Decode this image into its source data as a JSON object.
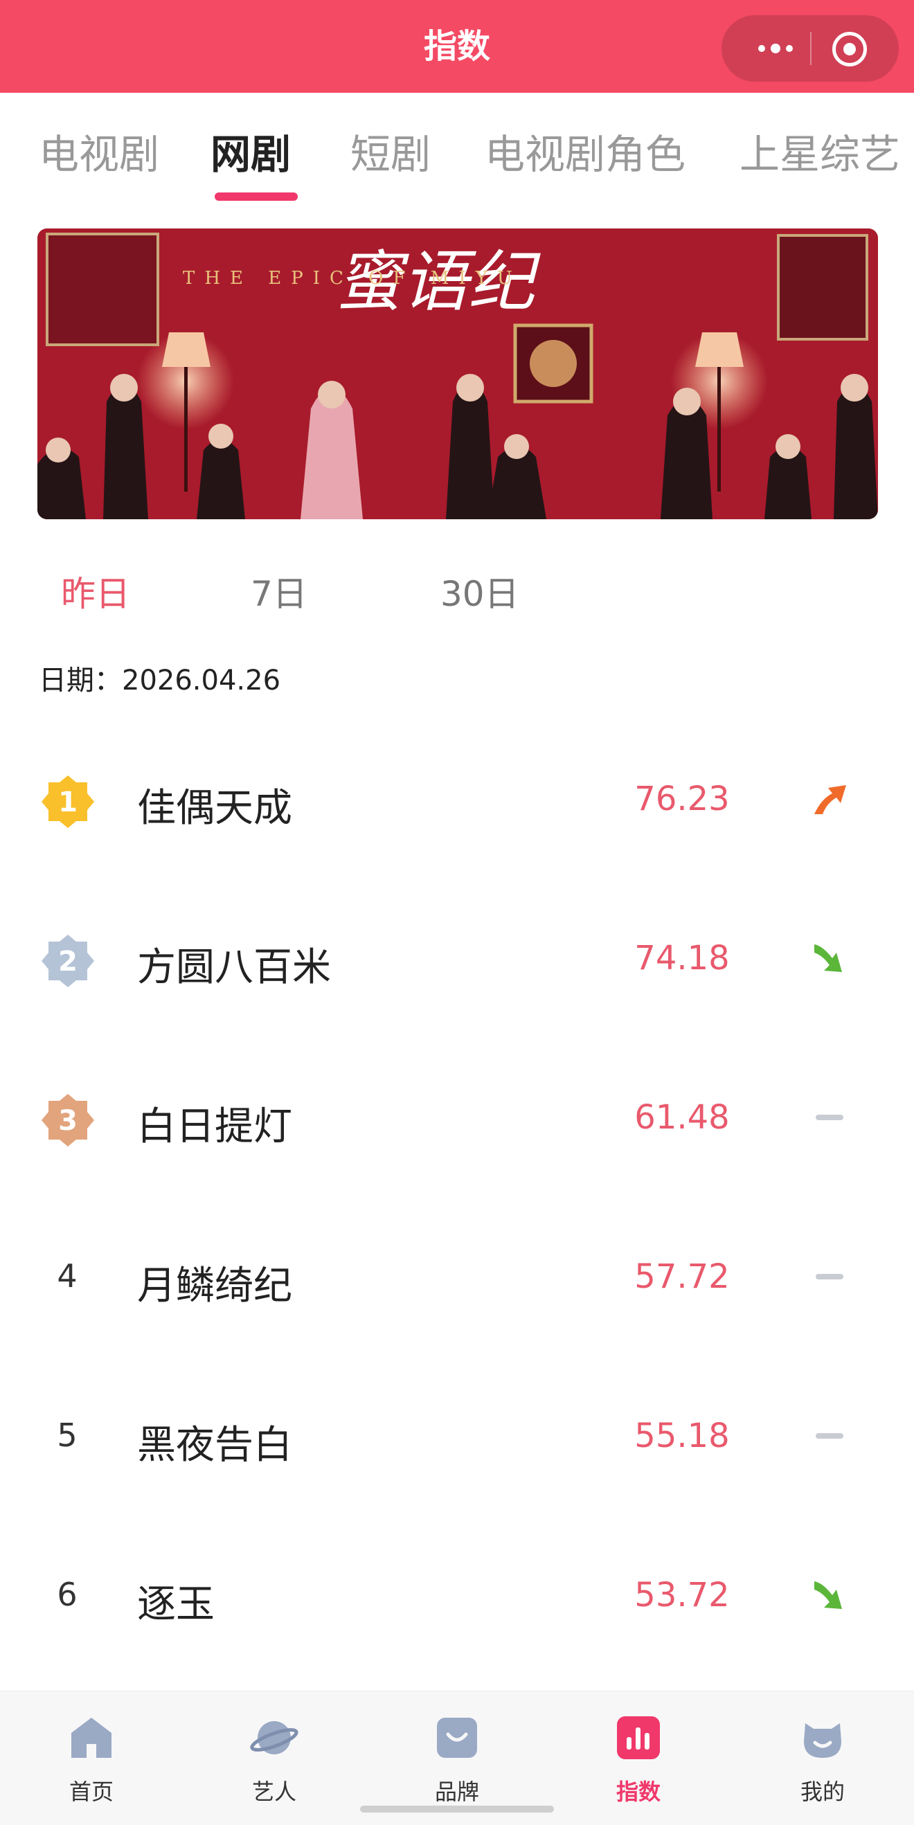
{
  "app": {
    "title": "指数"
  },
  "tabs": [
    {
      "label": "电视剧"
    },
    {
      "label": "网剧"
    },
    {
      "label": "短剧"
    },
    {
      "label": "电视剧角色"
    },
    {
      "label": "上星综艺"
    }
  ],
  "active_tab": "网剧",
  "banner": {
    "title": "蜜语纪",
    "subtitle": "THE EPIC OF MIYU"
  },
  "periods": [
    {
      "label": "昨日"
    },
    {
      "label": "7日"
    },
    {
      "label": "30日"
    }
  ],
  "date_line": "日期：2026.04.26",
  "ranking": [
    {
      "rank": "1",
      "name": "佳偶天成",
      "score": "76.23",
      "trend": "up-arrow-icon"
    },
    {
      "rank": "2",
      "name": "方圆八百米",
      "score": "74.18",
      "trend": "down-arrow-icon"
    },
    {
      "rank": "3",
      "name": "白日提灯",
      "score": "61.48",
      "trend": "flat-dash-icon"
    },
    {
      "rank": "4",
      "name": "月鳞绮纪",
      "score": "57.72",
      "trend": "flat-dash-icon"
    },
    {
      "rank": "5",
      "name": "黑夜告白",
      "score": "55.18",
      "trend": "flat-dash-icon"
    },
    {
      "rank": "6",
      "name": "逐玉",
      "score": "53.72",
      "trend": "down-arrow-icon"
    }
  ],
  "bottom_nav": [
    {
      "label": "首页",
      "icon": "home-icon"
    },
    {
      "label": "艺人",
      "icon": "planet-icon"
    },
    {
      "label": "品牌",
      "icon": "bag-icon"
    },
    {
      "label": "指数",
      "icon": "bar-chart-icon"
    },
    {
      "label": "我的",
      "icon": "face-icon"
    }
  ],
  "colors": {
    "brand": "#f44a64",
    "accent": "#f0386b",
    "score": "#e9596c",
    "up": "#f06a2a",
    "down": "#5bb63a",
    "flat": "#c9ccd3"
  }
}
